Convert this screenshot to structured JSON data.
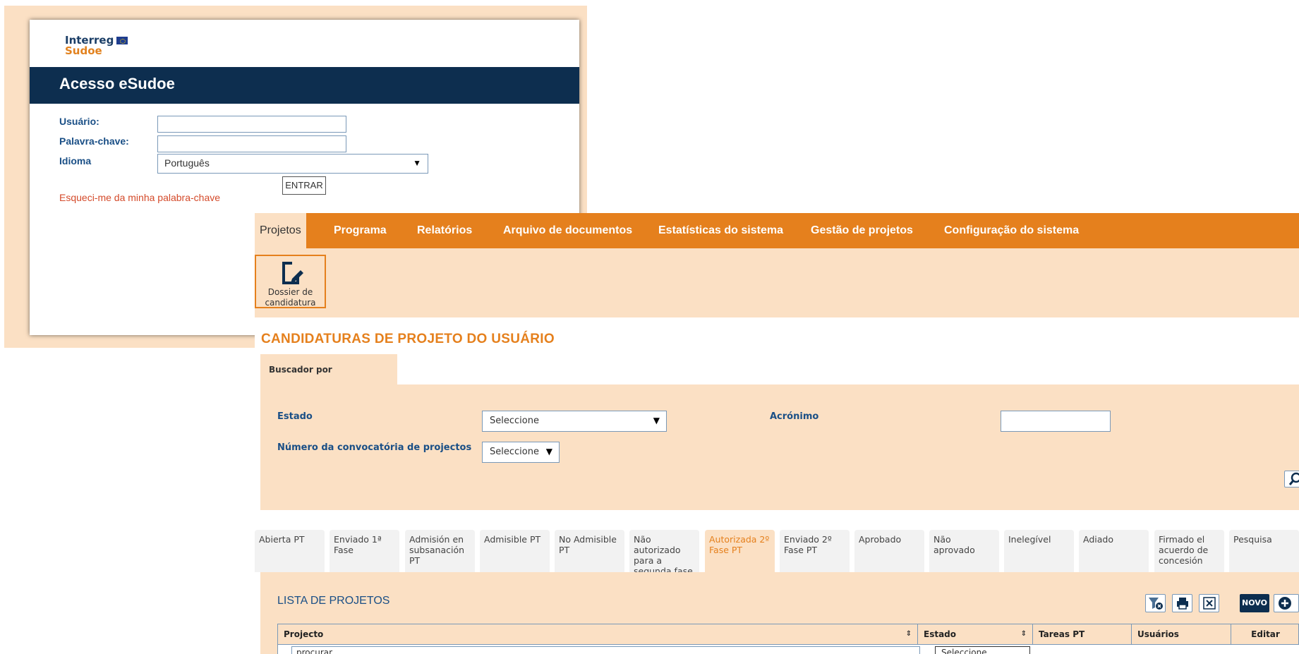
{
  "login": {
    "logo": {
      "line1": "Interreg",
      "line2": "Sudoe"
    },
    "title": "Acesso eSudoe",
    "user_label": "Usuário:",
    "password_label": "Palavra-chave:",
    "language_label": "Idioma",
    "language_value": "Português",
    "enter_button": "ENTRAR",
    "forgot_link": "Esqueci-me da minha palabra-chave"
  },
  "nav": {
    "items": [
      "Projetos",
      "Programa",
      "Relatórios",
      "Arquivo de documentos",
      "Estatísticas do sistema",
      "Gestão de projetos",
      "Configuração do sistema"
    ]
  },
  "subnav": {
    "dossier_line1": "Dossier de",
    "dossier_line2": "candidatura"
  },
  "page": {
    "title": "CANDIDATURAS DE PROJETO DO USUÁRIO"
  },
  "search": {
    "tab": "Buscador por Convocatoria",
    "estado_label": "Estado",
    "estado_value": "Seleccione",
    "acronimo_label": "Acrónimo",
    "numero_label": "Número da convocatória de projectos",
    "numero_value": "Seleccione"
  },
  "status_tabs": [
    "Abierta PT",
    "Enviado 1ª Fase",
    "Admisión en subsanación PT",
    "Admisible PT",
    "No Admisible PT",
    "Não autorizado para a segunda fase",
    "Autorizada 2º Fase PT",
    "Enviado 2º Fase PT",
    "Aprobado",
    "Não aprovado",
    "Inelegível",
    "Adiado",
    "Firmado el acuerdo de concesión",
    "Pesquisa"
  ],
  "list": {
    "title": "LISTA DE PROJETOS",
    "novo_button": "NOVO",
    "columns": [
      "Projecto",
      "Estado",
      "Tareas PT",
      "Usuários",
      "Editar"
    ],
    "filter_placeholder": "procurar",
    "estado_filter_value": "Seleccione"
  },
  "colors": {
    "orange": "#e5801d",
    "peach": "#fbe0c4",
    "navy": "#0d2e4f",
    "link_red": "#d44a2a"
  }
}
